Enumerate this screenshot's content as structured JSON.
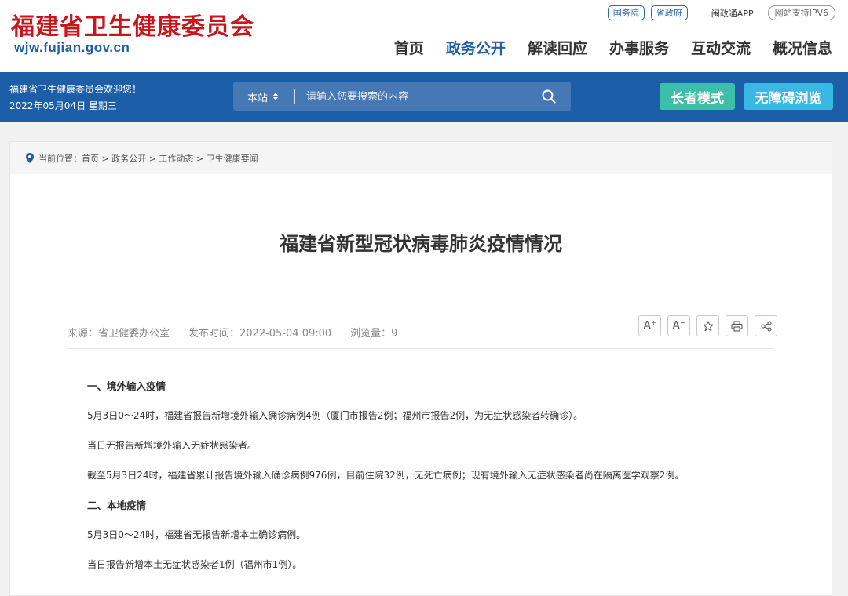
{
  "header": {
    "site_title": "福建省卫生健康委员会",
    "site_url": "wjw.fujian.gov.cn",
    "top_links": [
      "国务院",
      "省政府"
    ],
    "app_link": "闽政通APP",
    "ipv6": "网站支持IPV6",
    "nav": [
      "首页",
      "政务公开",
      "解读回应",
      "办事服务",
      "互动交流",
      "概况信息"
    ],
    "nav_active_index": 1
  },
  "bar": {
    "welcome": "福建省卫生健康委员会欢迎您！",
    "date": "2022年05月04日 星期三",
    "search_scope": "本站",
    "search_placeholder": "请输入您要搜索的内容",
    "elder_mode": "长者模式",
    "accessible": "无障碍浏览"
  },
  "breadcrumb": "当前位置：首页 > 政务公开 > 工作动态 > 卫生健康要闻",
  "article": {
    "title": "福建省新型冠状病毒肺炎疫情情况",
    "source": "来源：省卫健委办公室",
    "published": "发布时间：2022-05-04 09:00",
    "views": "浏览量：9",
    "paragraphs": [
      {
        "heading": true,
        "text": "一、境外输入疫情"
      },
      {
        "heading": false,
        "text": "5月3日0～24时，福建省报告新增境外输入确诊病例4例（厦门市报告2例；福州市报告2例，为无症状感染者转确诊）。"
      },
      {
        "heading": false,
        "text": "当日无报告新增境外输入无症状感染者。"
      },
      {
        "heading": false,
        "text": "截至5月3日24时，福建省累计报告境外输入确诊病例976例，目前住院32例，无死亡病例；现有境外输入无症状感染者尚在隔离医学观察2例。"
      },
      {
        "heading": true,
        "text": "二、本地疫情"
      },
      {
        "heading": false,
        "text": "5月3日0～24时，福建省无报告新增本土确诊病例。"
      },
      {
        "heading": false,
        "text": "当日报告新增本土无症状感染者1例（福州市1例）。"
      }
    ]
  },
  "colors": {
    "brand_red": "#c8161d",
    "brand_blue": "#1d5ea9",
    "elder_green": "#3dbfa7",
    "access_blue": "#39b8e4"
  }
}
